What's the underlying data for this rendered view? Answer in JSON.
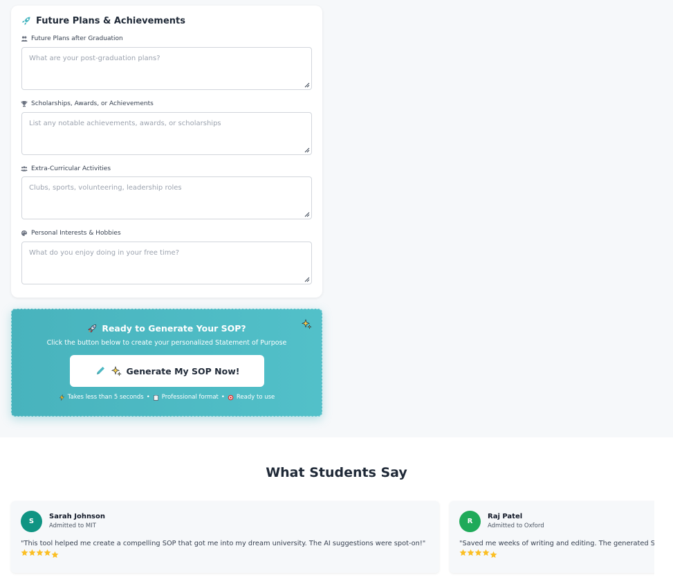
{
  "form_section": {
    "title": "Future Plans & Achievements",
    "fields": [
      {
        "label": "Future Plans after Graduation",
        "placeholder": "What are your post-graduation plans?",
        "icon": "graduation-icon"
      },
      {
        "label": "Scholarships, Awards, or Achievements",
        "placeholder": "List any notable achievements, awards, or scholarships",
        "icon": "trophy-icon"
      },
      {
        "label": "Extra-Curricular Activities",
        "placeholder": "Clubs, sports, volunteering, leadership roles",
        "icon": "users-icon"
      },
      {
        "label": "Personal Interests & Hobbies",
        "placeholder": "What do you enjoy doing in your free time?",
        "icon": "palette-icon"
      }
    ]
  },
  "cta": {
    "title": "Ready to Generate Your SOP?",
    "subtitle": "Click the button below to create your personalized Statement of Purpose",
    "button_label": "Generate My SOP Now!",
    "footer": [
      {
        "text": "Takes less than 5 seconds",
        "icon": "lightning-icon"
      },
      {
        "text": "Professional format",
        "icon": "clipboard-icon"
      },
      {
        "text": "Ready to use",
        "icon": "target-icon"
      }
    ],
    "separator": "•",
    "accent_color": "#4db8c2"
  },
  "testimonials": {
    "title": "What Students Say",
    "items": [
      {
        "initial": "S",
        "name": "Sarah Johnson",
        "subtitle": "Admitted to MIT",
        "quote": "\"This tool helped me create a compelling SOP that got me into my dream university. The AI suggestions were spot-on!\"",
        "rating": 5,
        "avatar_color": "#109483"
      },
      {
        "initial": "R",
        "name": "Raj Patel",
        "subtitle": "Admitted to Oxford",
        "quote": "\"Saved me weeks of writing and editing. The generated SOP was",
        "rating": 5,
        "avatar_color": "#1faa59"
      }
    ]
  }
}
